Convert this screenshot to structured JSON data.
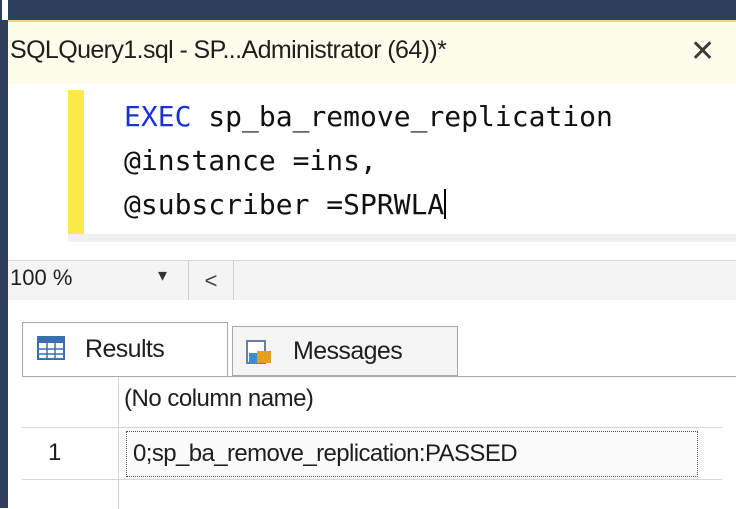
{
  "tab": {
    "title": "SQLQuery1.sql - SP...Administrator (64))*",
    "close_glyph": "✕"
  },
  "editor": {
    "lines": [
      {
        "keyword": "EXEC",
        "rest": " sp_ba_remove_replication"
      },
      {
        "keyword": "",
        "rest": "@instance =ins,"
      },
      {
        "keyword": "",
        "rest": "@subscriber =SPRWLA"
      }
    ],
    "keyword_color": "#1a31d6",
    "margin_color": "#f9e94a"
  },
  "status": {
    "zoom": "100 %",
    "zoom_arrow": "▾",
    "scroll_left": "<"
  },
  "results": {
    "tabs": [
      {
        "label": "Results",
        "icon": "grid-icon"
      },
      {
        "label": "Messages",
        "icon": "messages-icon"
      }
    ],
    "columns": [
      "(No column name)"
    ],
    "rows": [
      {
        "num": "1",
        "cells": [
          "0;sp_ba_remove_replication:PASSED"
        ]
      }
    ]
  }
}
